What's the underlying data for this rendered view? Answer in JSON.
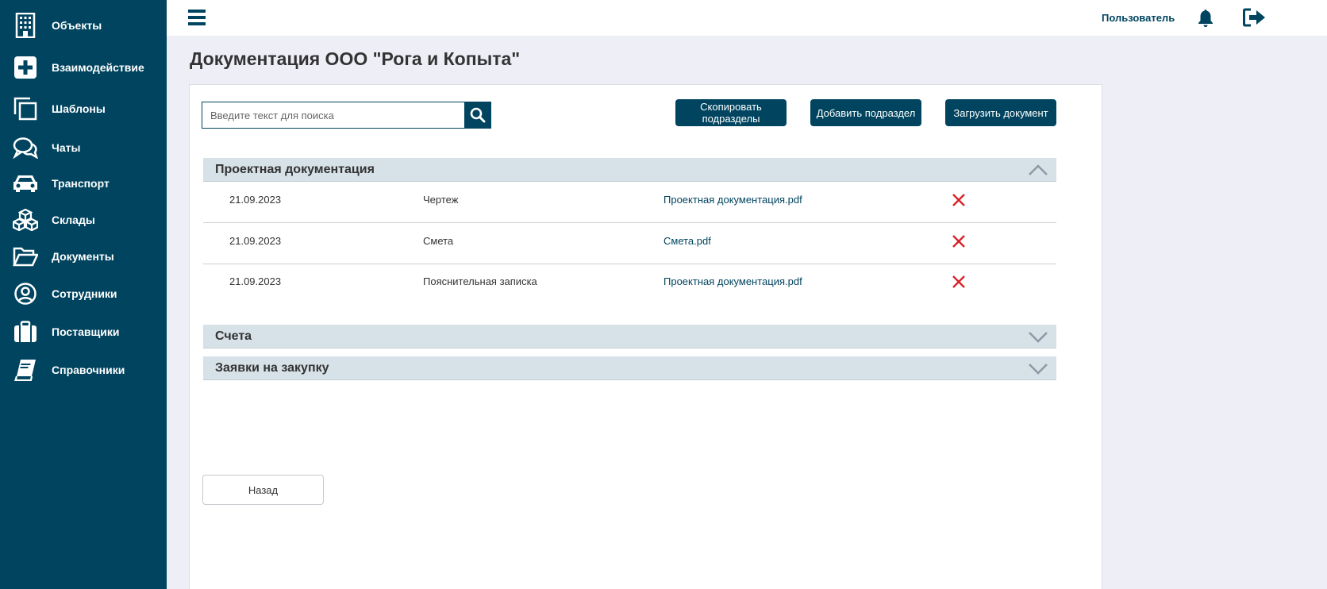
{
  "sidebar": {
    "items": [
      {
        "label": "Объекты",
        "icon": "building-icon"
      },
      {
        "label": "Взаимодействие",
        "icon": "plus-square-icon"
      },
      {
        "label": "Шаблоны",
        "icon": "copy-icon"
      },
      {
        "label": "Чаты",
        "icon": "chat-icon"
      },
      {
        "label": "Транспорт",
        "icon": "car-icon"
      },
      {
        "label": "Склады",
        "icon": "boxes-icon"
      },
      {
        "label": "Документы",
        "icon": "folder-open-icon"
      },
      {
        "label": "Сотрудники",
        "icon": "user-circle-icon"
      },
      {
        "label": "Поставщики",
        "icon": "briefcase-icon"
      },
      {
        "label": "Справочники",
        "icon": "book-icon"
      }
    ]
  },
  "topbar": {
    "user_label": "Пользователь"
  },
  "page": {
    "title": "Документация ООО \"Рога и Копыта\""
  },
  "search": {
    "placeholder": "Введите текст для поиска",
    "value": ""
  },
  "toolbar": {
    "copy_label": "Скопировать подразделы",
    "add_label": "Добавить подраздел",
    "upload_label": "Загрузить документ"
  },
  "sections": [
    {
      "title": "Проектная документация",
      "expanded": true,
      "rows": [
        {
          "date": "21.09.2023",
          "type": "Чертеж",
          "file": "Проектная документация.pdf"
        },
        {
          "date": "21.09.2023",
          "type": "Смета",
          "file": "Смета.pdf"
        },
        {
          "date": "21.09.2023",
          "type": "Пояснительная записка",
          "file": "Проектная документация.pdf"
        }
      ]
    },
    {
      "title": "Счета",
      "expanded": false,
      "rows": []
    },
    {
      "title": "Заявки на закупку",
      "expanded": false,
      "rows": []
    }
  ],
  "footer": {
    "back_label": "Назад"
  },
  "colors": {
    "brand": "#00445f",
    "delete": "#d9232a",
    "section_bg": "#d7e1e8",
    "page_bg": "#eeeff6"
  }
}
